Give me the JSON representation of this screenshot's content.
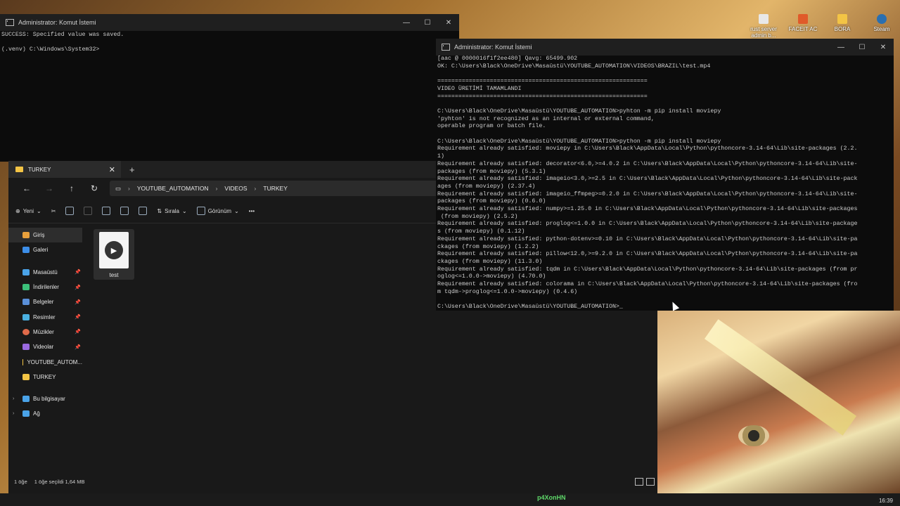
{
  "desktop": {
    "icons": [
      {
        "label": "rust server admin b...",
        "icon": "file-icon",
        "color": "#e8e8e8"
      },
      {
        "label": "FACEIT AC",
        "icon": "faceit-icon",
        "color": "#e05a2a"
      },
      {
        "label": "BORA",
        "icon": "folder-icon",
        "color": "#f3c445"
      },
      {
        "label": "Steam",
        "icon": "steam-icon",
        "color": "#2a6fb0"
      }
    ]
  },
  "cmd_small": {
    "title": "Administrator: Komut İstemi",
    "lines": "SUCCESS: Specified value was saved.\n\n(.venv) C:\\Windows\\System32>"
  },
  "cmd_large": {
    "title": "Administrator: Komut İstemi",
    "lines": "[aac @ 0000016f1f2ee480] Qavg: 65499.902\nOK: C:\\Users\\Black\\OneDrive\\Masaüstü\\YOUTUBE_AUTOMATION\\VIDEOS\\BRAZIL\\test.mp4\n\n============================================================\nVIDEO ÜRETİMİ TAMAMLANDI\n============================================================\n\nC:\\Users\\Black\\OneDrive\\Masaüstü\\YOUTUBE_AUTOMATION>pyhton -m pip install moviepy\n'pyhton' is not recognized as an internal or external command,\noperable program or batch file.\n\nC:\\Users\\Black\\OneDrive\\Masaüstü\\YOUTUBE_AUTOMATION>python -m pip install moviepy\nRequirement already satisfied: moviepy in C:\\Users\\Black\\AppData\\Local\\Python\\pythoncore-3.14-64\\Lib\\site-packages (2.2.\n1)\nRequirement already satisfied: decorator<6.0,>=4.0.2 in C:\\Users\\Black\\AppData\\Local\\Python\\pythoncore-3.14-64\\Lib\\site-\npackages (from moviepy) (5.3.1)\nRequirement already satisfied: imageio<3.0,>=2.5 in C:\\Users\\Black\\AppData\\Local\\Python\\pythoncore-3.14-64\\Lib\\site-pack\nages (from moviepy) (2.37.4)\nRequirement already satisfied: imageio_ffmpeg>=0.2.0 in C:\\Users\\Black\\AppData\\Local\\Python\\pythoncore-3.14-64\\Lib\\site-\npackages (from moviepy) (0.6.0)\nRequirement already satisfied: numpy>=1.25.0 in C:\\Users\\Black\\AppData\\Local\\Python\\pythoncore-3.14-64\\Lib\\site-packages\n (from moviepy) (2.5.2)\nRequirement already satisfied: proglog<=1.0.0 in C:\\Users\\Black\\AppData\\Local\\Python\\pythoncore-3.14-64\\Lib\\site-package\ns (from moviepy) (0.1.12)\nRequirement already satisfied: python-dotenv>=0.10 in C:\\Users\\Black\\AppData\\Local\\Python\\pythoncore-3.14-64\\Lib\\site-pa\nckages (from moviepy) (1.2.2)\nRequirement already satisfied: pillow<12.0,>=9.2.0 in C:\\Users\\Black\\AppData\\Local\\Python\\pythoncore-3.14-64\\Lib\\site-pa\nckages (from moviepy) (11.3.0)\nRequirement already satisfied: tqdm in C:\\Users\\Black\\AppData\\Local\\Python\\pythoncore-3.14-64\\Lib\\site-packages (from pr\noglog<=1.0.0->moviepy) (4.70.0)\nRequirement already satisfied: colorama in C:\\Users\\Black\\AppData\\Local\\Python\\pythoncore-3.14-64\\Lib\\site-packages (fro\nm tqdm->proglog<=1.0.0->moviepy) (0.4.6)\n\nC:\\Users\\Black\\OneDrive\\Masaüstü\\YOUTUBE_AUTOMATION>_"
  },
  "explorer": {
    "tab_title": "TURKEY",
    "breadcrumb": [
      "YOUTUBE_AUTOMATION",
      "VIDEOS",
      "TURKEY"
    ],
    "toolbar": {
      "new": "Yeni",
      "sort": "Sırala",
      "view": "Görünüm",
      "more": "•••"
    },
    "sidebar": [
      {
        "label": "Giriş",
        "icon": "home-icon",
        "color": "#e8a03c",
        "pinned": false
      },
      {
        "label": "Galeri",
        "icon": "gallery-icon",
        "color": "#3c8ee8",
        "pinned": false
      },
      {
        "label": "Masaüstü",
        "icon": "desktop-icon",
        "color": "#4aa3e8",
        "pinned": true
      },
      {
        "label": "İndirilenler",
        "icon": "download-icon",
        "color": "#3cc07a",
        "pinned": true
      },
      {
        "label": "Belgeler",
        "icon": "documents-icon",
        "color": "#5a8fd8",
        "pinned": true
      },
      {
        "label": "Resimler",
        "icon": "pictures-icon",
        "color": "#4ab0e0",
        "pinned": true
      },
      {
        "label": "Müzikler",
        "icon": "music-icon",
        "color": "#e06a4a",
        "pinned": true
      },
      {
        "label": "Videolar",
        "icon": "videos-icon",
        "color": "#9a6ae0",
        "pinned": true
      },
      {
        "label": "YOUTUBE_AUTOM...",
        "icon": "folder-icon",
        "color": "#f3c445",
        "pinned": false
      },
      {
        "label": "TURKEY",
        "icon": "folder-icon",
        "color": "#f3c445",
        "pinned": false
      },
      {
        "label": "Bu bilgisayar",
        "icon": "computer-icon",
        "color": "#4aa3e8",
        "pinned": false
      },
      {
        "label": "Ağ",
        "icon": "network-icon",
        "color": "#4aa3e8",
        "pinned": false
      }
    ],
    "file": {
      "name": "test",
      "icon": "video-file-icon"
    },
    "status": {
      "items": "1 öğe",
      "selected": "1 öğe seçildi  1,64 MB"
    }
  },
  "taskbar": {
    "center_text": "p4XonHN",
    "clock": "16:39"
  }
}
